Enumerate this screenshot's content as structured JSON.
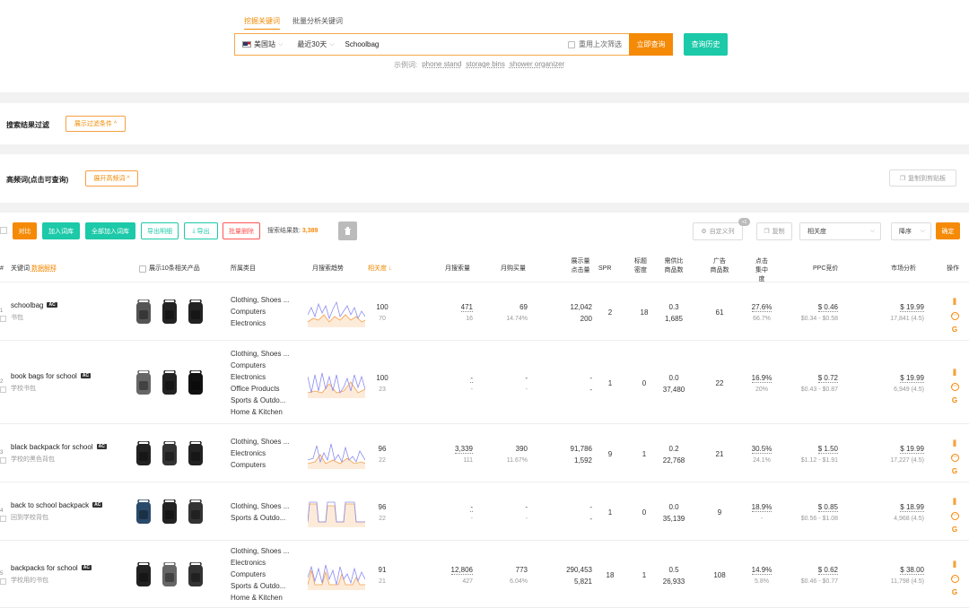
{
  "tabs": [
    "挖掘关键词",
    "批量分析关键词"
  ],
  "search": {
    "site": "美国站",
    "period": "最近30天",
    "keyword": "Schoolbag",
    "reuse": "重用上次筛选",
    "submit": "立即查询",
    "history": "查询历史"
  },
  "examples": {
    "label": "示例词:",
    "items": [
      "phone stand",
      "storage bins",
      "shower organizer"
    ]
  },
  "filter": {
    "label": "搜索结果过滤",
    "button": "展示过滤条件"
  },
  "freq": {
    "label": "高频词(点击可查询)",
    "button": "展开高频词",
    "copy": "复制到剪贴板"
  },
  "toolbar": {
    "compare": "对比",
    "add": "加入词库",
    "add_all": "全部加入词库",
    "export_detail": "导出明细",
    "export": "导出",
    "batch_delete": "批量删除",
    "result_label": "搜索结果数:",
    "result_count": "3,389",
    "custom_cols": "自定义列",
    "custom_badge": "+1",
    "copy": "复制",
    "sort_field": "相关度",
    "sort_order": "降序",
    "confirm": "确定"
  },
  "headers": {
    "keyword": "关键词",
    "data_explain": "数据解释",
    "show_products": "展示10条相关产品",
    "category": "所属类目",
    "trend": "月搜索趋势",
    "relevance": "相关度",
    "monthly_search": "月搜索量",
    "monthly_buy": "月购买量",
    "impressions_a": "展示量",
    "impressions_b": "点击量",
    "spr": "SPR",
    "title_a": "标题",
    "title_b": "密度",
    "supply_a": "需供比",
    "supply_b": "商品数",
    "ads_a": "广告",
    "ads_b": "商品数",
    "click_a": "点击",
    "click_b": "集中度",
    "ppc": "PPC竞价",
    "market": "市场分析",
    "ops": "操作"
  },
  "rows": [
    {
      "num": "1",
      "kw": "schoolbag",
      "cn": "书包",
      "cats": [
        "Clothing, Shoes ...",
        "Computers",
        "Electronics"
      ],
      "rel": "100",
      "rel_sub": "70",
      "ms": "471",
      "ms_sub": "16",
      "mb": "69",
      "mb_sub": "14.74%",
      "imp": "12,042",
      "clk": "200",
      "spr": "2",
      "td": "18",
      "ds": "0.3",
      "ds_sub": "1,685",
      "ads": "61",
      "cc": "27.6%",
      "cc_sub": "66.7%",
      "ppc": "$ 0.46",
      "ppc_sub": "$0.34 - $0.58",
      "mk": "$ 19.99",
      "mk_sub": "17,841 (4.5)"
    },
    {
      "num": "2",
      "kw": "book bags for school",
      "cn": "学校书包",
      "cats": [
        "Clothing, Shoes ...",
        "Computers",
        "Electronics",
        "Office Products",
        "Sports & Outdo...",
        "Home & Kitchen"
      ],
      "rel": "100",
      "rel_sub": "23",
      "ms": "-",
      "ms_sub": "-",
      "mb": "-",
      "mb_sub": "-",
      "imp": "-",
      "clk": "-",
      "spr": "1",
      "td": "0",
      "ds": "0.0",
      "ds_sub": "37,480",
      "ads": "22",
      "cc": "16.9%",
      "cc_sub": "20%",
      "ppc": "$ 0.72",
      "ppc_sub": "$0.43 - $0.87",
      "mk": "$ 19.99",
      "mk_sub": "6,949 (4.5)"
    },
    {
      "num": "3",
      "kw": "black backpack for school",
      "cn": "学校的黑色背包",
      "cats": [
        "Clothing, Shoes ...",
        "Electronics",
        "Computers"
      ],
      "rel": "96",
      "rel_sub": "22",
      "ms": "3,339",
      "ms_sub": "111",
      "mb": "390",
      "mb_sub": "11.67%",
      "imp": "91,786",
      "clk": "1,592",
      "spr": "9",
      "td": "1",
      "ds": "0.2",
      "ds_sub": "22,768",
      "ads": "21",
      "cc": "30.5%",
      "cc_sub": "24.1%",
      "ppc": "$ 1.50",
      "ppc_sub": "$1.12 - $1.91",
      "mk": "$ 19.99",
      "mk_sub": "17,227 (4.5)"
    },
    {
      "num": "4",
      "kw": "back to school backpack",
      "cn": "回到学校背包",
      "cats": [
        "Clothing, Shoes ...",
        "Sports & Outdo..."
      ],
      "rel": "96",
      "rel_sub": "22",
      "ms": "-",
      "ms_sub": "-",
      "mb": "-",
      "mb_sub": "-",
      "imp": "-",
      "clk": "-",
      "spr": "1",
      "td": "0",
      "ds": "0.0",
      "ds_sub": "35,139",
      "ads": "9",
      "cc": "18.9%",
      "cc_sub": "-",
      "ppc": "$ 0.85",
      "ppc_sub": "$0.56 - $1.08",
      "mk": "$ 18.99",
      "mk_sub": "4,968 (4.5)"
    },
    {
      "num": "5",
      "kw": "backpacks for school",
      "cn": "学校用的书包",
      "cats": [
        "Clothing, Shoes ...",
        "Electronics",
        "Computers",
        "Sports & Outdo...",
        "Home & Kitchen"
      ],
      "rel": "91",
      "rel_sub": "21",
      "ms": "12,806",
      "ms_sub": "427",
      "mb": "773",
      "mb_sub": "6.04%",
      "imp": "290,453",
      "clk": "5,821",
      "spr": "18",
      "td": "1",
      "ds": "0.5",
      "ds_sub": "26,933",
      "ads": "108",
      "cc": "14.9%",
      "cc_sub": "5.8%",
      "ppc": "$ 0.62",
      "ppc_sub": "$0.46 - $0.77",
      "mk": "$ 38.00",
      "mk_sub": "11,798 (4.5)"
    }
  ],
  "colors": {
    "accent": "#f58a07",
    "teal": "#1cc9a8",
    "danger": "#ff5555"
  }
}
